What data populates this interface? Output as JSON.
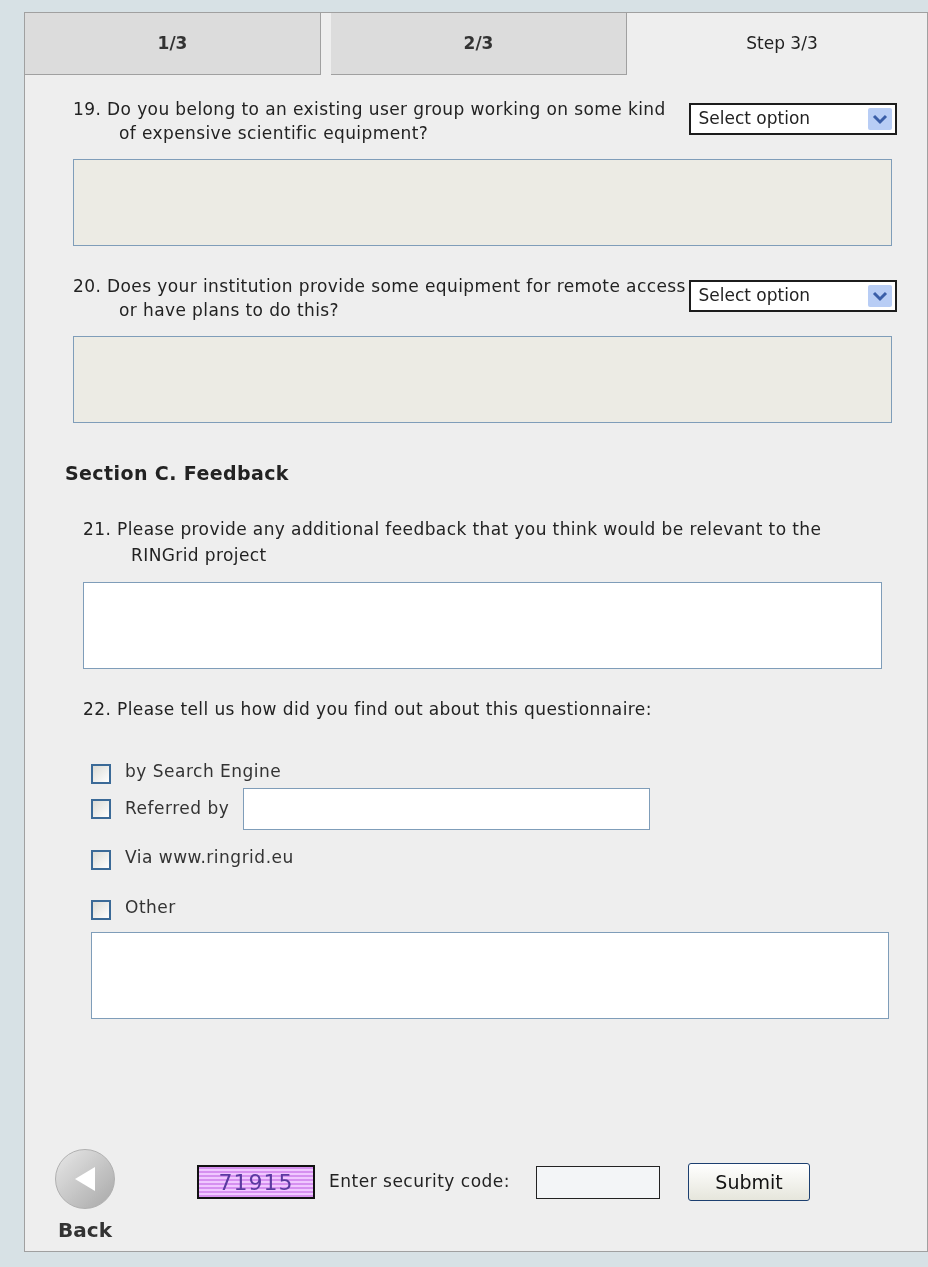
{
  "tabs": [
    {
      "label": "1/3",
      "selected": false
    },
    {
      "label": "2/3",
      "selected": false
    },
    {
      "label": "Step 3/3",
      "selected": true
    }
  ],
  "questions_b": [
    {
      "text": "19. Do you belong to an existing user group working on some kind of expensive scientific equipment?",
      "select": "Select option"
    },
    {
      "text": "20. Does your institution provide some equipment for remote access or have plans to do this?",
      "select": "Select option"
    }
  ],
  "section_heading": "Section C. Feedback",
  "q21": "21. Please provide any additional feedback that you think would be relevant to the RINGrid project",
  "q22": "22. Please tell us how did you find out about this questionnaire:",
  "options": [
    {
      "kind": "plain",
      "label": "by Search Engine",
      "checked": false
    },
    {
      "kind": "with_field",
      "label": "Referred by",
      "checked": false
    },
    {
      "kind": "plain",
      "label": "Via www.ringrid.eu",
      "checked": false
    },
    {
      "kind": "with_area",
      "label": "Other",
      "checked": false
    }
  ],
  "footer": {
    "back": "Back",
    "captcha": "71915",
    "code_label": "Enter security code:",
    "submit": "Submit"
  }
}
